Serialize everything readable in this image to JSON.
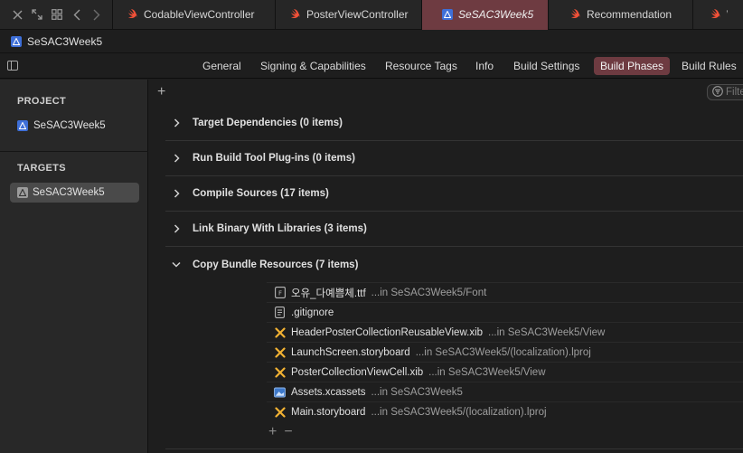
{
  "tabs": [
    {
      "label": "CodableViewController",
      "icon": "swift-file-icon",
      "active": false
    },
    {
      "label": "PosterViewController",
      "icon": "swift-file-icon",
      "active": false
    },
    {
      "label": "SeSAC3Week5",
      "icon": "project-icon",
      "active": true
    },
    {
      "label": "Recommendation",
      "icon": "swift-file-icon",
      "active": false
    },
    {
      "label": "W",
      "icon": "swift-file-icon",
      "active": false
    }
  ],
  "breadcrumb": {
    "project": "SeSAC3Week5"
  },
  "editor_tabs": [
    {
      "label": "General"
    },
    {
      "label": "Signing & Capabilities"
    },
    {
      "label": "Resource Tags"
    },
    {
      "label": "Info"
    },
    {
      "label": "Build Settings"
    },
    {
      "label": "Build Phases",
      "active": true
    },
    {
      "label": "Build Rules"
    }
  ],
  "sidebar": {
    "project_heading": "PROJECT",
    "project_item": "SeSAC3Week5",
    "targets_heading": "TARGETS",
    "target_item": "SeSAC3Week5"
  },
  "filter": {
    "placeholder": "Filte"
  },
  "phases": [
    {
      "title": "Target Dependencies (0 items)",
      "expanded": false
    },
    {
      "title": "Run Build Tool Plug-ins (0 items)",
      "expanded": false
    },
    {
      "title": "Compile Sources (17 items)",
      "expanded": false
    },
    {
      "title": "Link Binary With Libraries (3 items)",
      "expanded": false
    },
    {
      "title": "Copy Bundle Resources (7 items)",
      "expanded": true
    }
  ],
  "files": [
    {
      "name": "오유_다예쁨체.ttf",
      "location": "...in SeSAC3Week5/Font",
      "icon": "font-file-icon"
    },
    {
      "name": ".gitignore",
      "location": "",
      "icon": "text-file-icon"
    },
    {
      "name": "HeaderPosterCollectionReusableView.xib",
      "location": "...in SeSAC3Week5/View",
      "icon": "interface-builder-icon"
    },
    {
      "name": "LaunchScreen.storyboard",
      "location": "...in SeSAC3Week5/(localization).lproj",
      "icon": "interface-builder-icon"
    },
    {
      "name": "PosterCollectionViewCell.xib",
      "location": "...in SeSAC3Week5/View",
      "icon": "interface-builder-icon"
    },
    {
      "name": "Assets.xcassets",
      "location": "...in SeSAC3Week5",
      "icon": "asset-catalog-icon"
    },
    {
      "name": "Main.storyboard",
      "location": "...in SeSAC3Week5/(localization).lproj",
      "icon": "interface-builder-icon"
    }
  ],
  "colors": {
    "accent": "#6e3b41",
    "swift": "#f05138",
    "ib": "#f2b233",
    "project": "#3e6fd8"
  }
}
